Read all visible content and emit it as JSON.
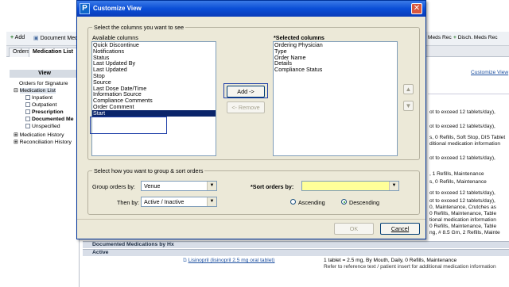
{
  "background": {
    "toolbar": {
      "add_label": "Add",
      "document_med_label": "Document Medi",
      "meds_rec_label": "Meds Rec",
      "disch_meds_rec_label": "Disch. Meds Rec"
    },
    "tabs": [
      "Orders",
      "Medication List"
    ],
    "left_panel": {
      "view_header": "View",
      "items": {
        "orders_for_signature": "Orders for Signature",
        "medication_list": "Medication List",
        "inpatient": "Inpatient",
        "outpatient": "Outpatient",
        "prescription": "Prescription",
        "documented_meds": "Documented Me",
        "unspecified": "Unspecified",
        "medication_history": "Medication History",
        "reconciliation_history": "Reconciliation History"
      }
    },
    "customize_view_link": "Customize View",
    "right_rows": [
      "ot to exceed 12 tablets/day),",
      "ot to exceed 12 tablets/day),",
      "s, 0 Refills, Soft Stop, DIS Tablet",
      "ditional medication information",
      "ot to exceed 12 tablets/day),",
      ", 1 Refills, Maintenance",
      "s, 0 Refills, Maintenance",
      "ot to exceed 12 tablets/day),",
      "ot to exceed 12 tablets/day),",
      "0, Maintenance, Crutches as",
      "0 Refills, Maintenance, Table",
      "tional medication information",
      "0 Refills, Maintenance, Table",
      "ng, # 8.5 Gm, 2 Refills, Mainte"
    ],
    "documented_section": "Documented Medications by Hx",
    "active_label": "Active",
    "med_link": "Lisinopril (lisinopril 2.5 mg oral tablet)",
    "med_detail": "1 tablet = 2.5 mg, By Mouth, Daily, 0 Refills, Maintenance",
    "med_note": "Refer to reference text / patient insert for additional medication information"
  },
  "dialog": {
    "title": "Customize View",
    "icon_letter": "P",
    "columns_group_label": "Select the columns you want to see",
    "available_header": "Available columns",
    "available_columns": [
      "Quick Discontinue",
      "Notifications",
      "Status",
      "Last Updated By",
      "Last Updated",
      "Stop",
      "Source",
      "Last Dose Date/Time",
      "Information Source",
      "Compliance Comments",
      "Order Comment",
      "Start"
    ],
    "selected_available": "Start",
    "selected_header": "*Selected columns",
    "selected_columns": [
      "Ordering Physician",
      "Type",
      "Order Name",
      "Details",
      "Compliance Status"
    ],
    "add_button": "Add ->",
    "remove_button": "<- Remove",
    "group_sort_label": "Select how you want to group & sort orders",
    "group_orders_label": "Group orders by:",
    "group_orders_value": "Venue",
    "then_by_label": "Then by:",
    "then_by_value": "Active / Inactive",
    "sort_orders_label": "*Sort orders by:",
    "sort_orders_value": "",
    "ascending_label": "Ascending",
    "descending_label": "Descending",
    "sort_direction": "Descending",
    "ok_button": "OK",
    "cancel_button": "Cancel"
  },
  "colors": {
    "title_bar": "#0a4ed6",
    "dialog_bg": "#ece9d8",
    "selection": "#0a246a",
    "sort_field": "#ffff99",
    "highlight_outline": "#1f3fa8"
  }
}
